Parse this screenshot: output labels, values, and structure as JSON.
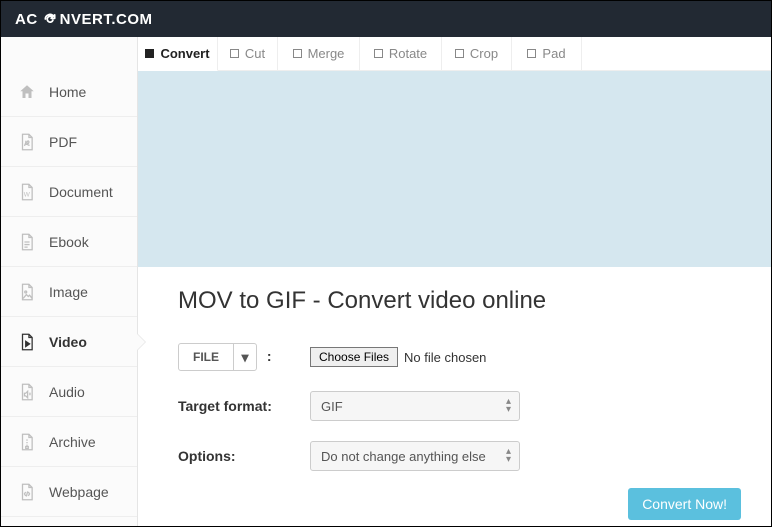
{
  "brand": {
    "part1": "AC",
    "part2": "NVERT.COM"
  },
  "sidebar": {
    "items": [
      {
        "label": "Home"
      },
      {
        "label": "PDF"
      },
      {
        "label": "Document"
      },
      {
        "label": "Ebook"
      },
      {
        "label": "Image"
      },
      {
        "label": "Video"
      },
      {
        "label": "Audio"
      },
      {
        "label": "Archive"
      },
      {
        "label": "Webpage"
      }
    ]
  },
  "tabs": [
    {
      "label": "Convert"
    },
    {
      "label": "Cut"
    },
    {
      "label": "Merge"
    },
    {
      "label": "Rotate"
    },
    {
      "label": "Crop"
    },
    {
      "label": "Pad"
    }
  ],
  "page": {
    "title": "MOV to GIF - Convert video online"
  },
  "form": {
    "source_label": "FILE",
    "choose_label": "Choose Files",
    "no_file": "No file chosen",
    "target_label": "Target format:",
    "target_value": "GIF",
    "options_label": "Options:",
    "options_value": "Do not change anything else",
    "submit_label": "Convert Now!"
  }
}
